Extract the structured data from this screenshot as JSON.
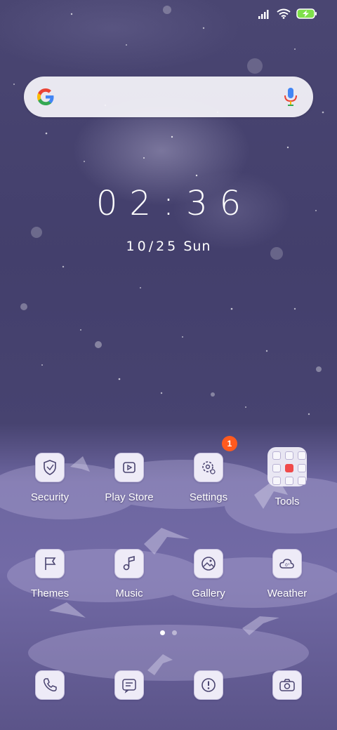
{
  "status_bar": {
    "signal_icon": "signal-bars-icon",
    "wifi_icon": "wifi-icon",
    "battery_icon": "battery-charging-icon",
    "battery_color": "#7ee04a"
  },
  "search": {
    "logo_icon": "google-g-icon",
    "mic_icon": "microphone-icon"
  },
  "clock": {
    "time": "02:36",
    "date_numbers": "10/25",
    "day": "Sun"
  },
  "apps_row1": [
    {
      "label": "Security",
      "icon": "security-shield-icon"
    },
    {
      "label": "Play Store",
      "icon": "play-store-icon"
    },
    {
      "label": "Settings",
      "icon": "settings-gear-icon",
      "badge": "1"
    },
    {
      "label": "Tools",
      "icon": "tools-folder-icon"
    }
  ],
  "apps_row2": [
    {
      "label": "Themes",
      "icon": "themes-flag-icon"
    },
    {
      "label": "Music",
      "icon": "music-note-icon"
    },
    {
      "label": "Gallery",
      "icon": "gallery-icon"
    },
    {
      "label": "Weather",
      "icon": "weather-icon"
    }
  ],
  "dock": [
    {
      "icon": "phone-icon"
    },
    {
      "icon": "messages-icon"
    },
    {
      "icon": "notes-icon"
    },
    {
      "icon": "camera-icon"
    }
  ],
  "page_indicator": {
    "pages": 2,
    "active": 1
  },
  "colors": {
    "badge": "#ff5a1f",
    "icon_stroke": "#4a4470",
    "icon_bg": "#eeebf7"
  }
}
